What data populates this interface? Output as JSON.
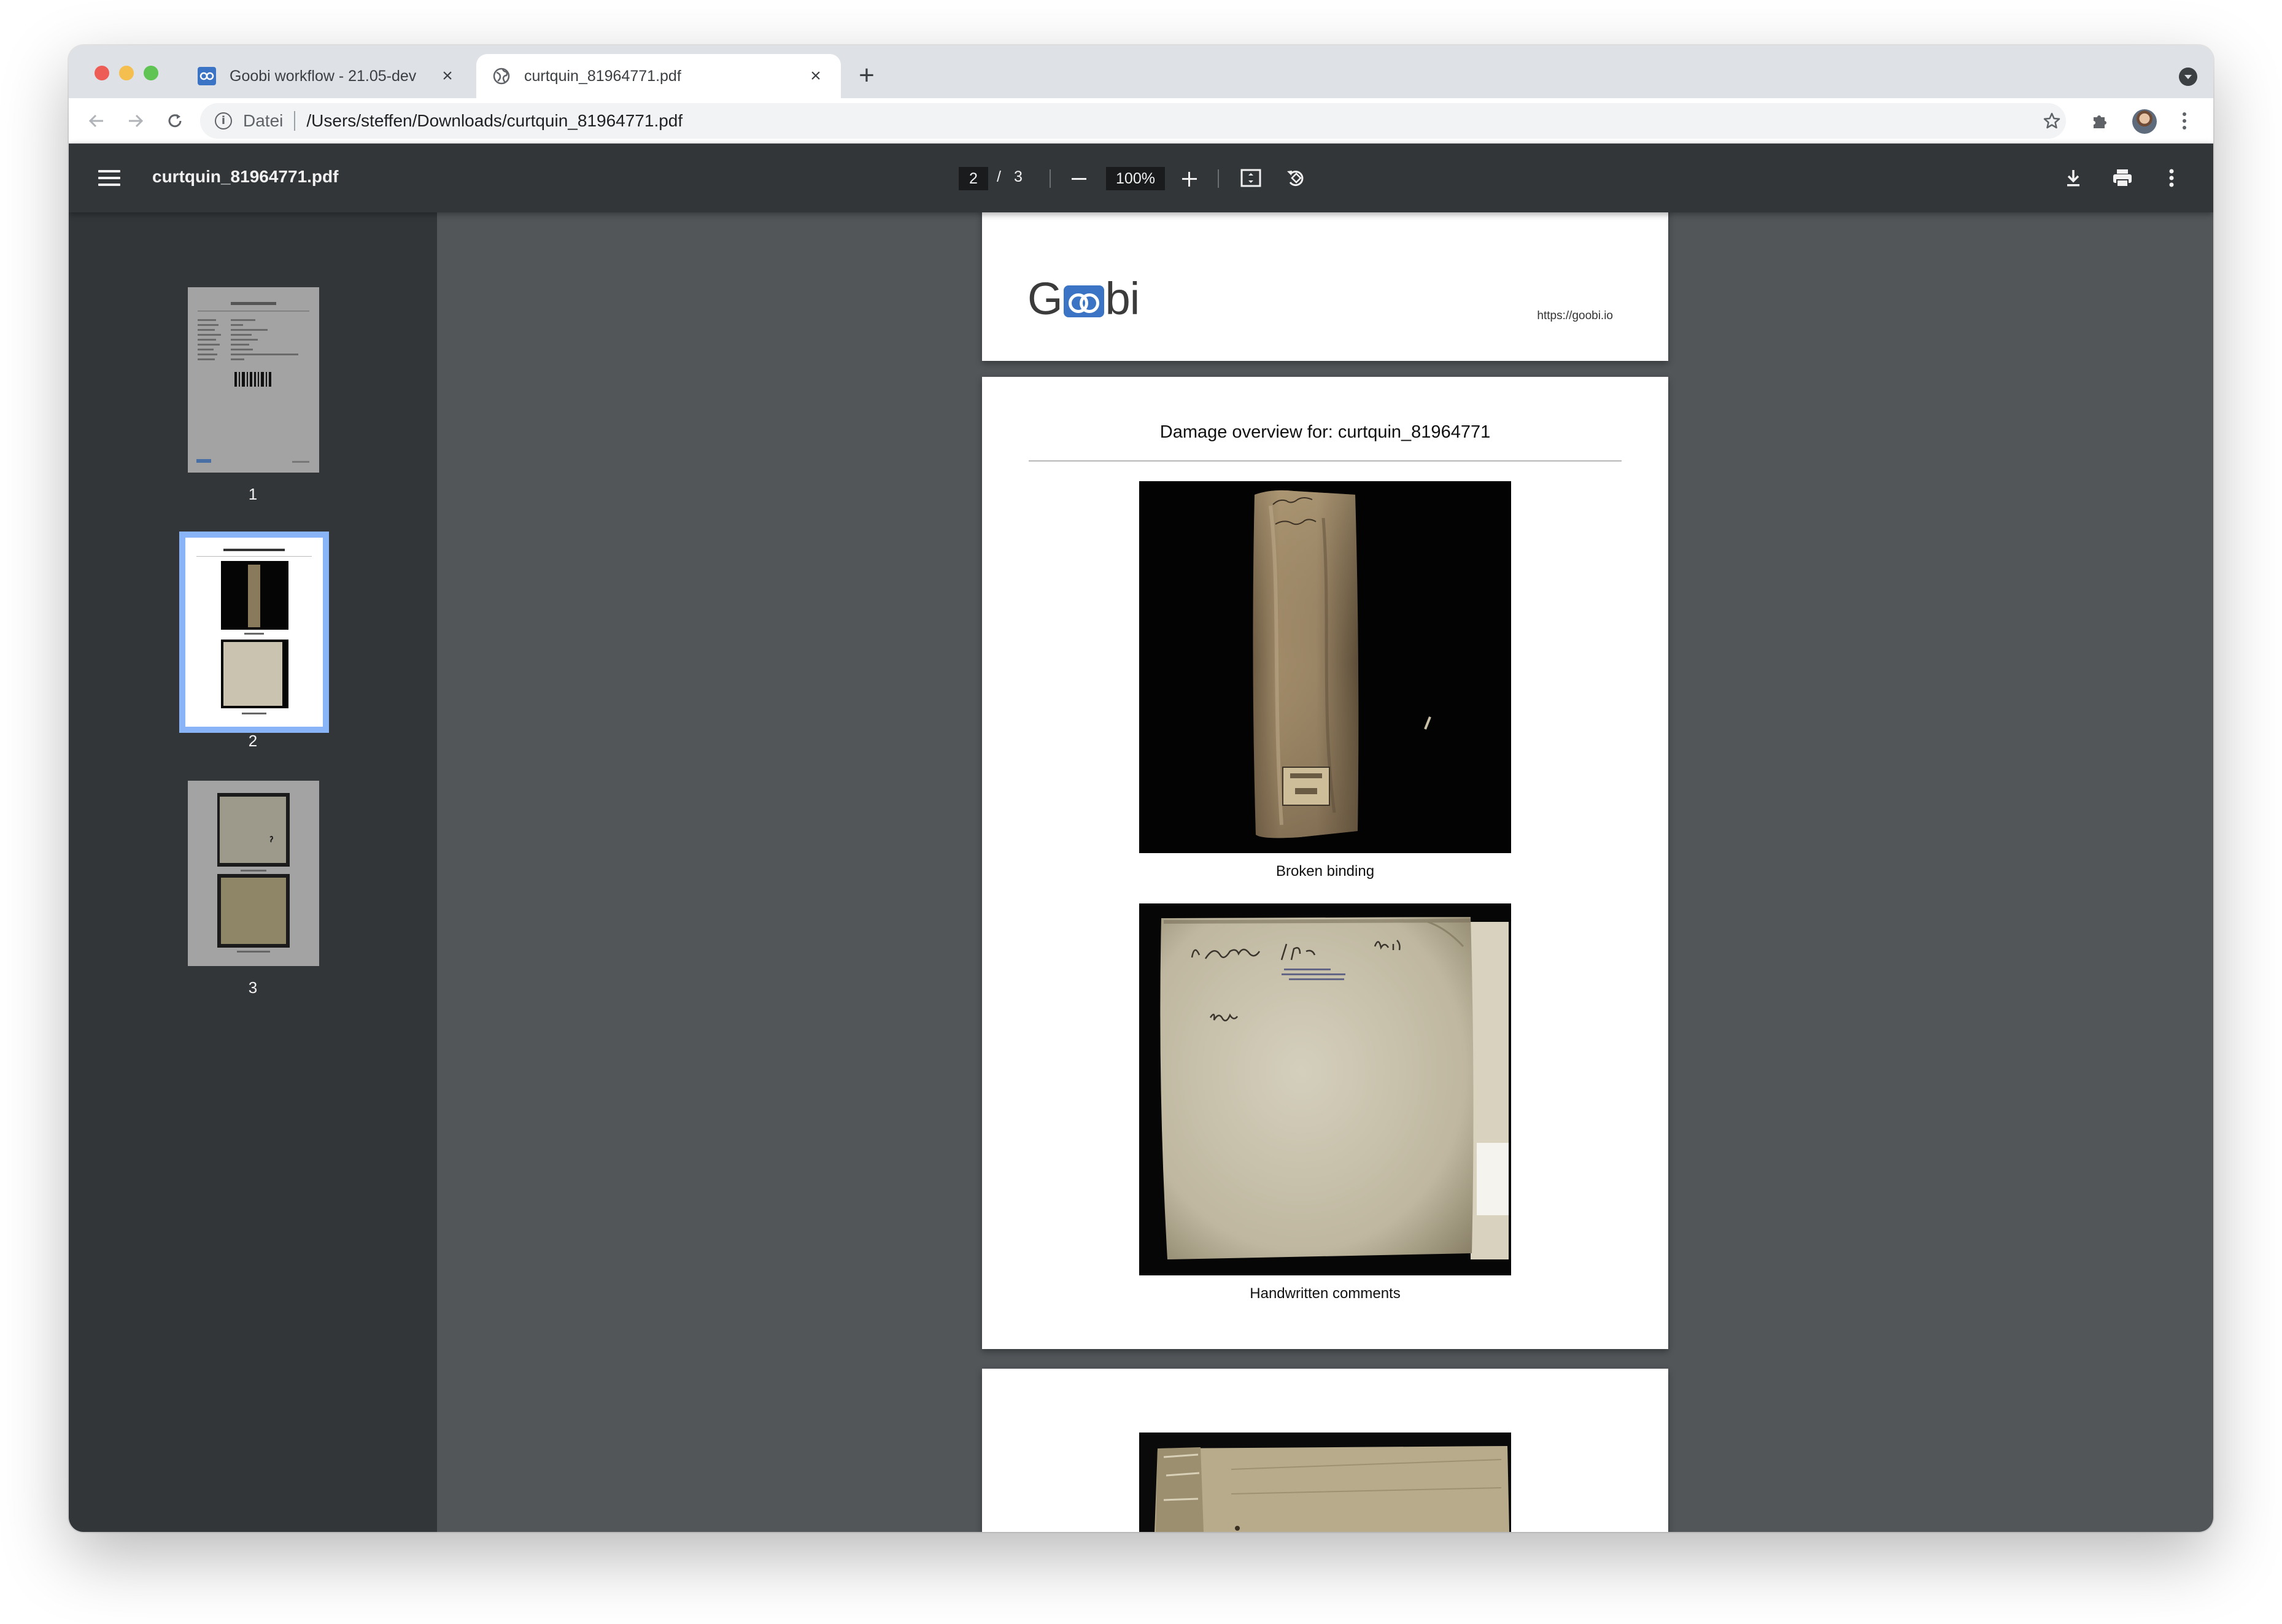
{
  "browser": {
    "tabs": [
      {
        "title": "Goobi workflow - 21.05-dev",
        "icon": "goobi-favicon",
        "active": false
      },
      {
        "title": "curtquin_81964771.pdf",
        "icon": "globe-icon",
        "active": true
      }
    ],
    "address": {
      "scheme_label": "Datei",
      "url": "/Users/steffen/Downloads/curtquin_81964771.pdf"
    }
  },
  "pdf_viewer": {
    "document_title": "curtquin_81964771.pdf",
    "current_page": "2",
    "page_separator": "/",
    "total_pages": "3",
    "zoom": "100%",
    "thumbnails": [
      {
        "number": "1",
        "selected": false
      },
      {
        "number": "2",
        "selected": true
      },
      {
        "number": "3",
        "selected": false
      }
    ]
  },
  "pages": {
    "header": {
      "logo_text_left": "G",
      "logo_text_right": "bi",
      "url": "https://goobi.io"
    },
    "damage": {
      "title": "Damage overview for: curtquin_81964771",
      "items": [
        {
          "caption": "Broken binding"
        },
        {
          "caption": "Handwritten comments"
        }
      ]
    }
  },
  "colors": {
    "pdf_toolbar": "#323639",
    "viewer_background": "#525659",
    "selection": "#8ab4f8",
    "goobi_blue": "#3b74c4"
  }
}
